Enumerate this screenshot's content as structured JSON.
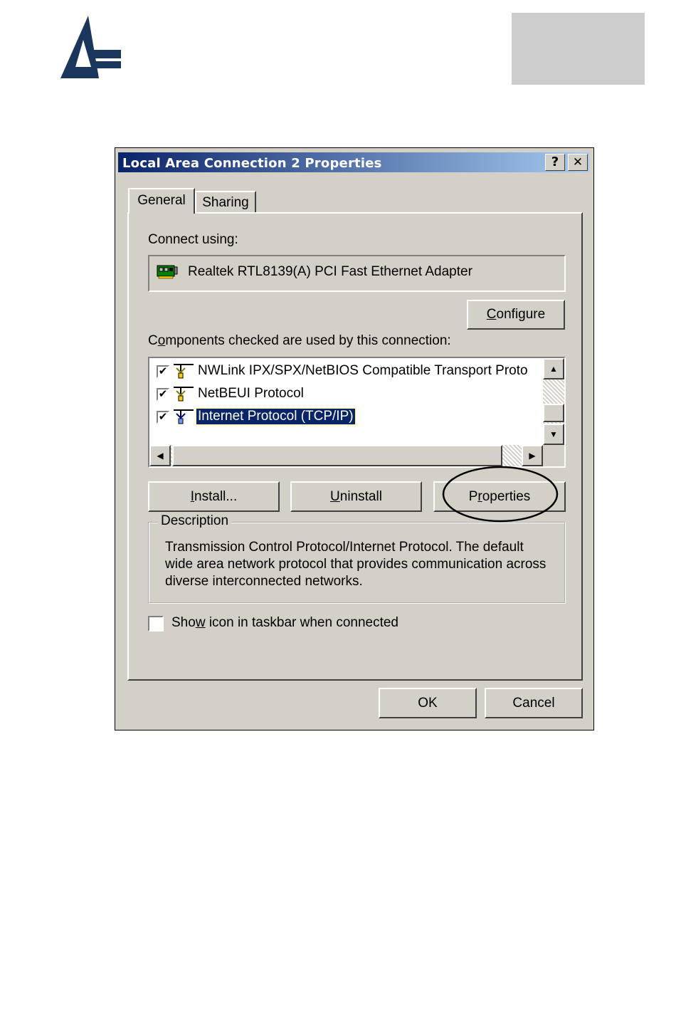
{
  "dialog": {
    "title": "Local Area Connection 2 Properties",
    "help_btn": "?",
    "close_btn": "✕",
    "tabs": [
      {
        "label": "General",
        "active": true
      },
      {
        "label": "Sharing",
        "active": false
      }
    ],
    "connect_using_label": "Connect using:",
    "adapter_name": "Realtek RTL8139(A) PCI Fast Ethernet Adapter",
    "configure_button": {
      "before": "",
      "accel": "C",
      "after": "onfigure"
    },
    "components_label": {
      "before": "C",
      "accel": "o",
      "after": "mponents checked are used by this connection:"
    },
    "components": [
      {
        "label": "NWLink IPX/SPX/NetBIOS Compatible Transport Proto",
        "checked": true,
        "selected": false
      },
      {
        "label": "NetBEUI Protocol",
        "checked": true,
        "selected": false
      },
      {
        "label": "Internet Protocol (TCP/IP)",
        "checked": true,
        "selected": true
      }
    ],
    "check_mark": "✔",
    "install_button": {
      "before": "",
      "accel": "I",
      "after": "nstall..."
    },
    "uninstall_button": {
      "before": "",
      "accel": "U",
      "after": "ninstall"
    },
    "properties_button": {
      "before": "P",
      "accel": "r",
      "after": "operties"
    },
    "description_legend": "Description",
    "description_text": "Transmission Control Protocol/Internet Protocol. The default wide area network protocol that provides communication across diverse interconnected networks.",
    "show_icon_label": {
      "before": "Sho",
      "accel": "w",
      "after": " icon in taskbar when connected"
    },
    "show_icon_checked": false,
    "ok_button": "OK",
    "cancel_button": "Cancel"
  },
  "icons": {
    "logo": "atlantis-logo",
    "adapter": "network-adapter-icon",
    "protocol": "network-protocol-icon"
  },
  "colors": {
    "logo_navy": "#1b365d",
    "titlebar_start": "#0a246a",
    "titlebar_end": "#a6caf0",
    "dialog_face": "#d4d0c8",
    "selection": "#0a246a",
    "corner_box": "#cccccc"
  }
}
